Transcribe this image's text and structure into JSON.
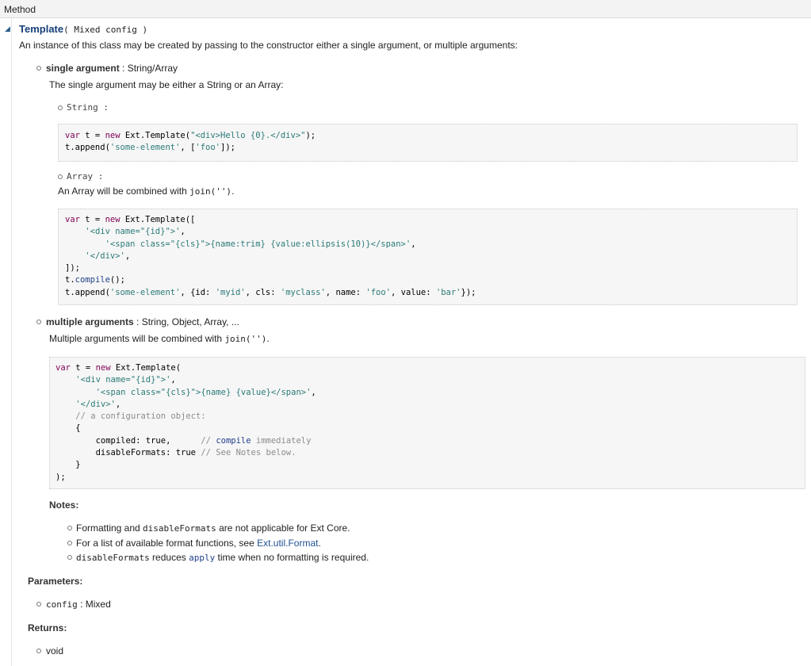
{
  "header": {
    "label": "Method"
  },
  "method": {
    "name": "Template",
    "signature": "( Mixed config )",
    "description": "An instance of this class may be created by passing to the constructor either a single argument, or multiple arguments:"
  },
  "single": {
    "title": "single argument",
    "types": " : String/Array",
    "desc": "The single argument may be either a String or an Array:",
    "string_label": "String",
    "string_suffix": " :",
    "array_label": "Array",
    "array_suffix": " :",
    "array_desc_prefix": "An Array will be combined with ",
    "array_desc_code": "join('')",
    "array_desc_suffix": "."
  },
  "code_string": {
    "l1a": "var",
    "l1b": " t = ",
    "l1c": "new",
    "l1d": " Ext.Template(",
    "l1e": "\"<div>Hello {0}.</div>\"",
    "l1f": ");",
    "l2a": "t.append(",
    "l2b": "'some-element'",
    "l2c": ", [",
    "l2d": "'foo'",
    "l2e": "]);"
  },
  "code_array": {
    "l1a": "var",
    "l1b": " t = ",
    "l1c": "new",
    "l1d": " Ext.Template([",
    "l2": "'<div name=\"{id}\">'",
    "l2s": ",",
    "l3": "'<span class=\"{cls}\">{name:trim} {value:ellipsis(10)}</span>'",
    "l3s": ",",
    "l4": "'</div>'",
    "l4s": ",",
    "l5": "]);",
    "l6a": "t.",
    "l6b": "compile",
    "l6c": "();",
    "l7a": "t.append(",
    "l7b": "'some-element'",
    "l7c": ", {id: ",
    "l7d": "'myid'",
    "l7e": ", cls: ",
    "l7f": "'myclass'",
    "l7g": ", name: ",
    "l7h": "'foo'",
    "l7i": ", value: ",
    "l7j": "'bar'",
    "l7k": "});"
  },
  "multiple": {
    "title": "multiple arguments",
    "types": " : String, Object, Array, ...",
    "desc_prefix": "Multiple arguments will be combined with ",
    "desc_code": "join('')",
    "desc_suffix": "."
  },
  "code_multi": {
    "l1a": "var",
    "l1b": " t = ",
    "l1c": "new",
    "l1d": " Ext.Template(",
    "l2": "'<div name=\"{id}\">'",
    "l2s": ",",
    "l3": "'<span class=\"{cls}\">{name} {value}</span>'",
    "l3s": ",",
    "l4": "'</div>'",
    "l4s": ",",
    "l5": "// a configuration object:",
    "l6": "{",
    "l7a": "compiled: true,",
    "l7b": "// ",
    "l7c": "compile",
    "l7d": " immediately",
    "l8a": "disableFormats: true ",
    "l8b": "// See Notes below.",
    "l9": "}",
    "l10": ");"
  },
  "notes": {
    "title": "Notes:",
    "n1_prefix": "Formatting and ",
    "n1_code": "disableFormats",
    "n1_suffix": " are not applicable for Ext Core.",
    "n2_prefix": "For a list of available format functions, see ",
    "n2_link": "Ext.util.Format",
    "n2_suffix": ".",
    "n3_code": "disableFormats",
    "n3_mid": " reduces ",
    "n3_code2": "apply",
    "n3_suffix": " time when no formatting is required."
  },
  "parameters": {
    "title": "Parameters:",
    "name": "config",
    "type": " : Mixed"
  },
  "returns": {
    "title": "Returns:",
    "value": "void"
  }
}
